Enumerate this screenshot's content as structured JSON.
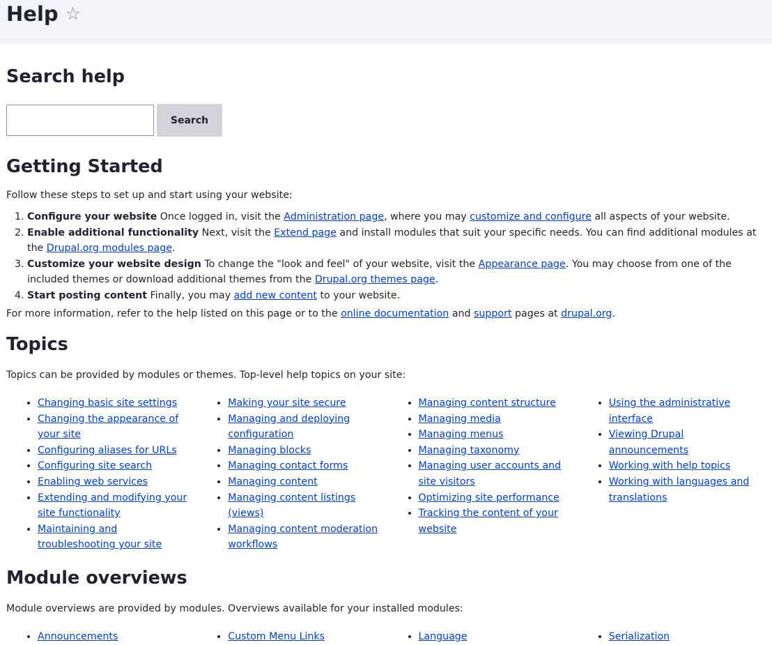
{
  "header": {
    "title": "Help",
    "favorite_icon": "star-outline-icon",
    "favorite_glyph": "☆",
    "background_color": "#f3f4f9"
  },
  "search": {
    "heading": "Search help",
    "placeholder": "",
    "value": "",
    "button_label": "Search"
  },
  "getting_started": {
    "heading": "Getting Started",
    "intro": "Follow these steps to set up and start using your website:",
    "steps": [
      {
        "title": "Configure your website",
        "parts": [
          " Once logged in, visit the ",
          "Administration page",
          ", where you may ",
          "customize and configure",
          " all aspects of your website."
        ]
      },
      {
        "title": "Enable additional functionality",
        "parts": [
          " Next, visit the ",
          "Extend page",
          " and install modules that suit your specific needs. You can find additional modules at the ",
          "Drupal.org modules page",
          "."
        ]
      },
      {
        "title": "Customize your website design",
        "parts": [
          " To change the \"look and feel\" of your website, visit the ",
          "Appearance page",
          ". You may choose from one of the included themes or download additional themes from the ",
          "Drupal.org themes page",
          "."
        ]
      },
      {
        "title": "Start posting content",
        "parts": [
          " Finally, you may ",
          "add new content",
          " to your website."
        ]
      }
    ],
    "more_info": [
      "For more information, refer to the help listed on this page or to the ",
      "online documentation",
      " and ",
      "support",
      " pages at ",
      "drupal.org",
      "."
    ]
  },
  "topics": {
    "heading": "Topics",
    "intro": "Topics can be provided by modules or themes. Top-level help topics on your site:",
    "columns": [
      [
        "Changing basic site settings",
        "Changing the appearance of your site",
        "Configuring aliases for URLs",
        "Configuring site search",
        "Enabling web services",
        "Extending and modifying your site functionality",
        "Maintaining and troubleshooting your site"
      ],
      [
        "Making your site secure",
        "Managing and deploying configuration",
        "Managing blocks",
        "Managing contact forms",
        "Managing content",
        "Managing content listings (views)",
        "Managing content moderation workflows"
      ],
      [
        "Managing content structure",
        "Managing media",
        "Managing menus",
        "Managing taxonomy",
        "Managing user accounts and site visitors",
        "Optimizing site performance",
        "Tracking the content of your website"
      ],
      [
        "Using the administrative interface",
        "Viewing Drupal announcements",
        "Working with help topics",
        "Working with languages and translations"
      ]
    ]
  },
  "module_overviews": {
    "heading": "Module overviews",
    "intro": "Module overviews are provided by modules. Overviews available for your installed modules:",
    "columns": [
      [
        "Announcements"
      ],
      [
        "Custom Menu Links"
      ],
      [
        "Language"
      ],
      [
        "Serialization"
      ]
    ]
  },
  "colors": {
    "link": "#003ecc",
    "text": "#222330",
    "button_bg": "#d3d4d9"
  }
}
